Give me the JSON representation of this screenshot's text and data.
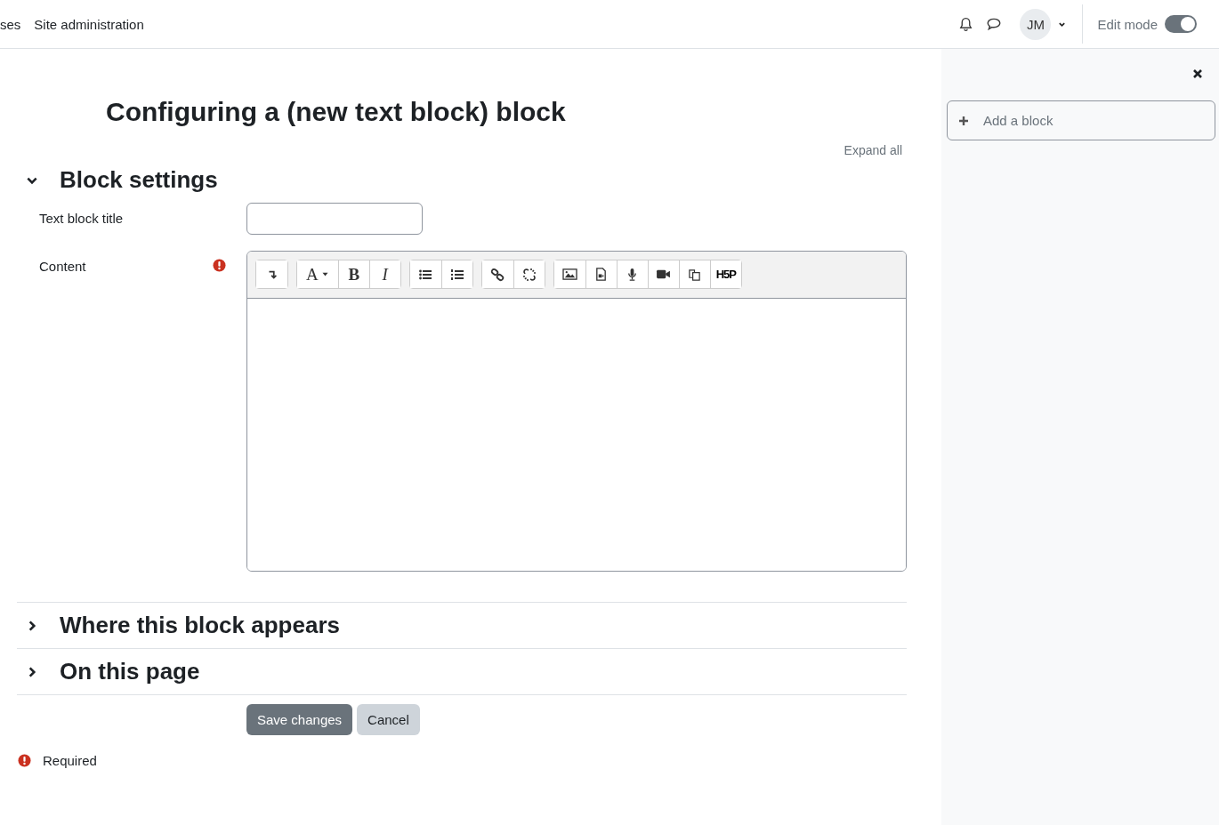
{
  "nav": {
    "links": [
      {
        "label": "ses"
      },
      {
        "label": "Site administration"
      }
    ],
    "avatar": "JM",
    "edit_mode": {
      "label": "Edit mode",
      "on": true
    }
  },
  "page": {
    "title": "Configuring a (new text block) block",
    "expand_all": "Expand all",
    "sections": [
      {
        "title": "Block settings",
        "expanded": true
      },
      {
        "title": "Where this block appears",
        "expanded": false
      },
      {
        "title": "On this page",
        "expanded": false
      }
    ],
    "fields": {
      "title_label": "Text block title",
      "content_label": "Content",
      "content_required": true
    },
    "toolbar": [
      [
        {
          "kind": "collapse"
        }
      ],
      [
        {
          "kind": "font",
          "label": "A"
        },
        {
          "kind": "bold",
          "label": "B"
        },
        {
          "kind": "italic",
          "label": "I"
        }
      ],
      [
        {
          "kind": "bullets"
        },
        {
          "kind": "numbers"
        }
      ],
      [
        {
          "kind": "link"
        },
        {
          "kind": "unlink"
        }
      ],
      [
        {
          "kind": "image"
        },
        {
          "kind": "media"
        },
        {
          "kind": "mic"
        },
        {
          "kind": "video"
        },
        {
          "kind": "copy"
        },
        {
          "kind": "logo",
          "label": "H5P"
        }
      ]
    ],
    "buttons": [
      {
        "label": "Save changes",
        "primary": true
      },
      {
        "label": "Cancel",
        "primary": false
      }
    ],
    "required_note": "Required"
  },
  "drawer": {
    "add_block": "Add a block"
  }
}
